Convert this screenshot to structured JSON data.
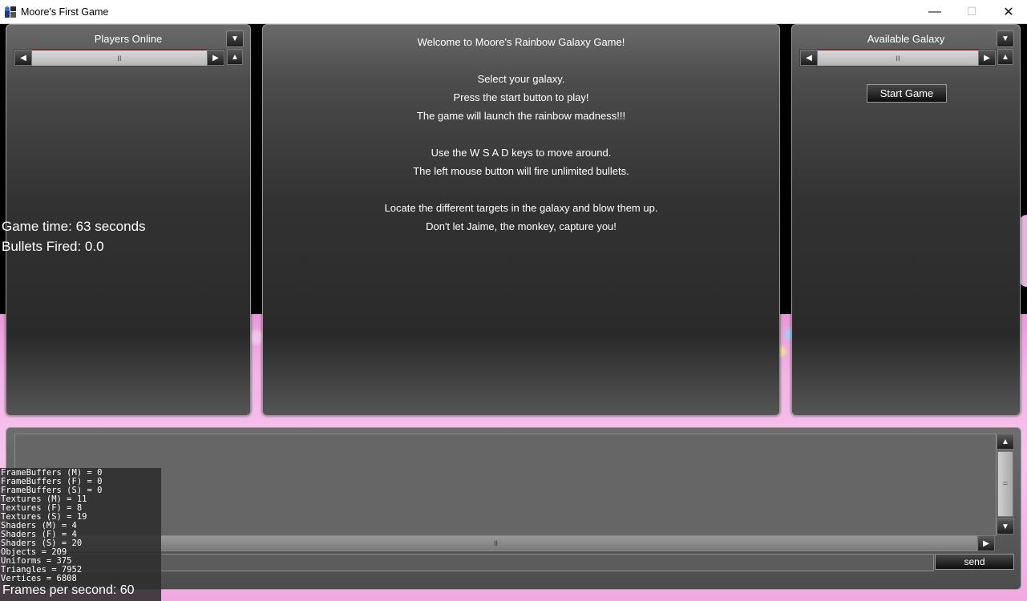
{
  "window": {
    "title": "Moore's First Game",
    "minimize_glyph": "—",
    "maximize_glyph": "☐",
    "close_glyph": "✕"
  },
  "players_panel": {
    "title": "Players Online",
    "dropdown_glyph": "▼",
    "left_arrow": "◀",
    "right_arrow": "▶",
    "up_arrow": "▲",
    "thumb_glyph": "II"
  },
  "welcome_panel": {
    "lines": [
      "Welcome to Moore's Rainbow Galaxy Game!",
      "",
      "Select your galaxy.",
      "Press the start button to play!",
      "The game will launch the rainbow madness!!!",
      "",
      "Use the W S A D keys to move around.",
      "The left mouse button will fire unlimited bullets.",
      "",
      "Locate the different targets in the galaxy and blow them up.",
      "Don't let Jaime, the monkey, capture you!"
    ]
  },
  "galaxy_panel": {
    "title": "Available Galaxy",
    "dropdown_glyph": "▼",
    "left_arrow": "◀",
    "right_arrow": "▶",
    "up_arrow": "▲",
    "thumb_glyph": "II",
    "start_button": "Start Game"
  },
  "hud": {
    "game_time": "Game time: 63 seconds",
    "bullets_fired": "Bullets Fired: 0.0",
    "fps": "Frames per second: 60"
  },
  "chat": {
    "up_arrow": "▲",
    "down_arrow": "▼",
    "right_arrow": "▶",
    "v_thumb_glyph": "=",
    "h_thumb_glyph": "II",
    "input_value": "",
    "send_label": "send"
  },
  "stats": [
    "FrameBuffers (M) = 0",
    "FrameBuffers (F) = 0",
    "FrameBuffers (S) = 0",
    "Textures (M) = 11",
    "Textures (F) = 8",
    "Textures (S) = 19",
    "Shaders (M) = 4",
    "Shaders (F) = 4",
    "Shaders (S) = 20",
    "Objects = 209",
    "Uniforms = 375",
    "Triangles = 7952",
    "Vertices = 6808"
  ]
}
